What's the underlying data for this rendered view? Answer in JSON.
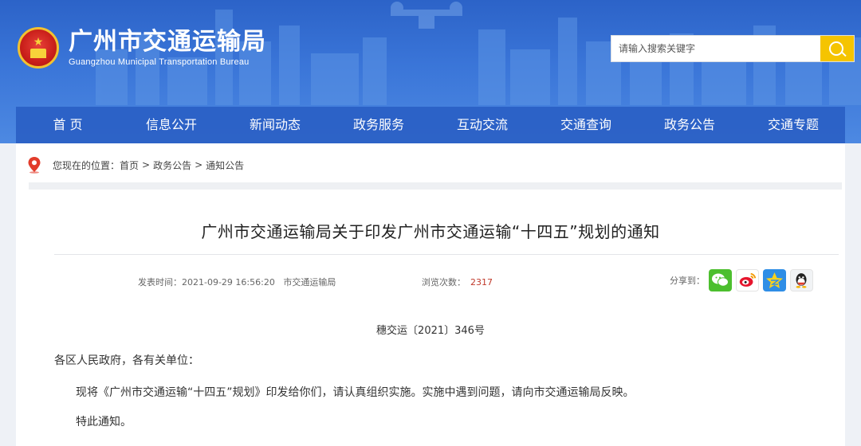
{
  "site": {
    "name_cn": "广州市交通运输局",
    "name_en": "Guangzhou Municipal Transportation Bureau"
  },
  "search": {
    "placeholder": "请输入搜索关键字"
  },
  "nav": {
    "items": [
      "首 页",
      "信息公开",
      "新闻动态",
      "政务服务",
      "互动交流",
      "交通查询",
      "政务公告",
      "交通专题"
    ]
  },
  "breadcrumb": {
    "prefix": "您现在的位置：",
    "items": [
      "首页",
      "政务公告",
      "通知公告"
    ],
    "separator": ">"
  },
  "article": {
    "title": "广州市交通运输局关于印发广州市交通运输“十四五”规划的通知",
    "publish_label": "发表时间：",
    "publish_time": "2021-09-29 16:56:20",
    "source": "市交通运输局",
    "views_label": "浏览次数：",
    "views": "2317",
    "share_label": "分享到：",
    "doc_number": "穗交运〔2021〕346号",
    "salutation": "各区人民政府，各有关单位：",
    "body": "现将《广州市交通运输“十四五”规划》印发给你们，请认真组织实施。实施中遇到问题，请向市交通运输局反映。",
    "closing": "特此通知。"
  },
  "share_icons": [
    "wechat-icon",
    "weibo-icon",
    "qzone-icon",
    "qq-icon"
  ],
  "colors": {
    "header_blue": "#3a75d8",
    "nav_blue": "#2a60c4",
    "search_button": "#f5c400",
    "view_count": "#c0392b"
  }
}
